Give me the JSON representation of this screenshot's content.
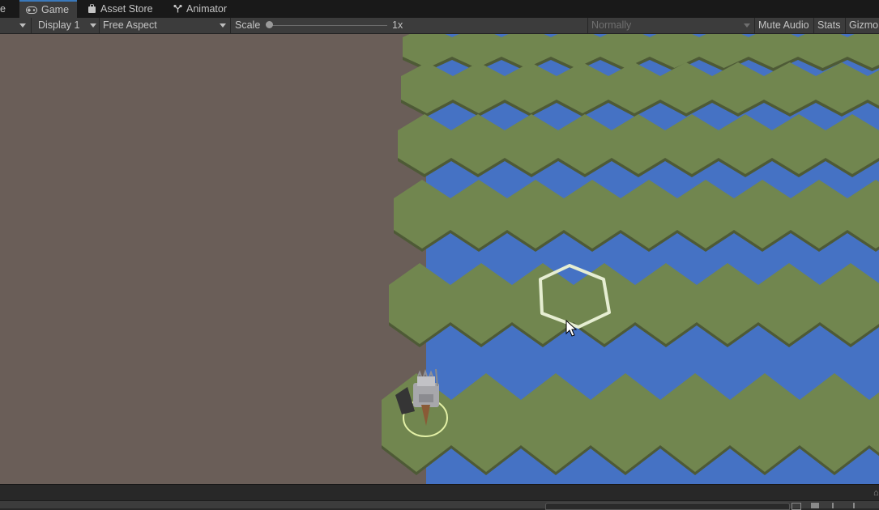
{
  "tabs": {
    "scene_partial": "e",
    "game": "Game",
    "asset_store": "Asset Store",
    "animator": "Animator"
  },
  "toolbar": {
    "display": "Display 1",
    "aspect": "Free Aspect",
    "scale_label": "Scale",
    "scale_value": "1x",
    "play_mode": "Normally",
    "mute_audio": "Mute Audio",
    "stats": "Stats",
    "gizmos": "Gizmo"
  },
  "scene": {
    "background": "#6a5e58",
    "grass_color": "#71864f",
    "grass_edge": "#4e5a36",
    "water_color": "#4572c4",
    "selection_color": "#e6eed2",
    "unit_ring_color": "#e3f0a6"
  },
  "colors": {
    "accent": "#3a79bb",
    "panel": "#3c3c3c",
    "tabbar": "#191919"
  },
  "icons": [
    "gamepad-icon",
    "bag-icon",
    "animator-icon",
    "cursor-icon",
    "knight-icon"
  ]
}
